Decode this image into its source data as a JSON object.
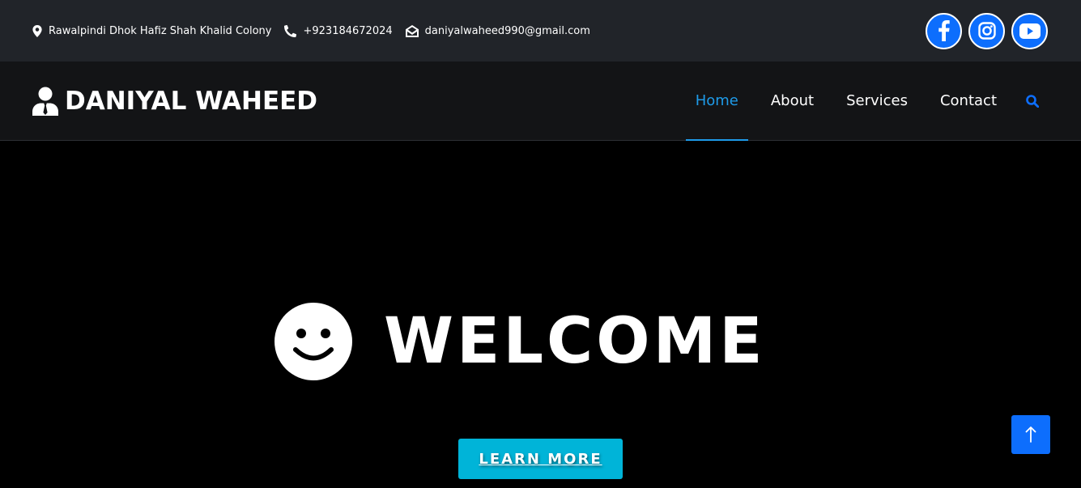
{
  "topbar": {
    "address": "Rawalpindi Dhok Hafiz Shah Khalid Colony",
    "phone": "+923184672024",
    "email": "daniyalwaheed990@gmail.com",
    "icons": [
      "map-pin-icon",
      "phone-icon",
      "envelope-open-icon"
    ],
    "socials": [
      {
        "name": "facebook",
        "icon": "facebook-icon"
      },
      {
        "name": "instagram",
        "icon": "instagram-icon"
      },
      {
        "name": "youtube",
        "icon": "youtube-icon"
      }
    ]
  },
  "navbar": {
    "brand": "DANIYAL WAHEED",
    "brand_icon": "user-tie-icon",
    "links": [
      "Home",
      "About",
      "Services",
      "Contact"
    ],
    "active": "Home",
    "search_icon": "search-icon"
  },
  "hero": {
    "title": "WELCOME",
    "title_icon": "smile-icon",
    "button": "LEARN MORE"
  },
  "back_to_top_icon": "arrow-up-icon",
  "colors": {
    "topbar_bg": "#212429",
    "navbar_bg": "#131416",
    "accent": "#1e9be9",
    "social_bg": "#0d6efd",
    "button_bg": "#00b4d8",
    "hero_bg": "#000000"
  }
}
